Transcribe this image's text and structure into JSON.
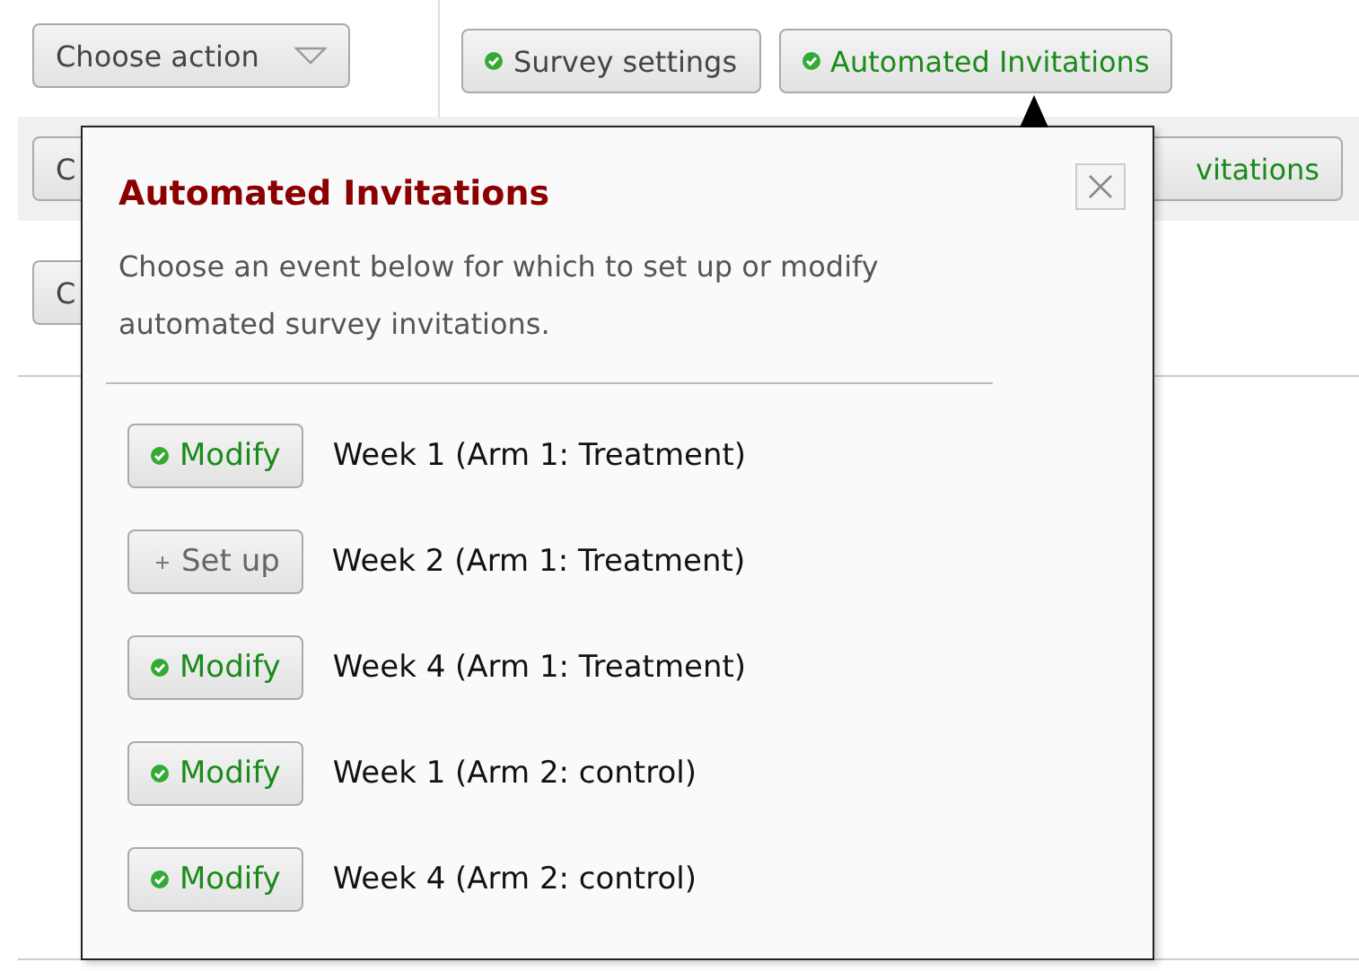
{
  "toolbar": {
    "action_menu": {
      "label": "Choose action"
    },
    "buttons": [
      {
        "label": "Survey settings",
        "highlighted": false
      },
      {
        "label": "Automated Invitations",
        "highlighted": true
      }
    ]
  },
  "rows_behind": [
    {
      "left_button": "C",
      "right_button": "vitations"
    },
    {
      "left_button": "C"
    }
  ],
  "popover": {
    "title": "Automated Invitations",
    "description": "Choose an event below for which to set up or modify automated survey invitations.",
    "events": [
      {
        "action": {
          "label": "Modify",
          "kind": "modify"
        },
        "name": "Week 1 (Arm 1: Treatment)"
      },
      {
        "action": {
          "label": "Set up",
          "kind": "setup"
        },
        "name": "Week 2 (Arm 1: Treatment)"
      },
      {
        "action": {
          "label": "Modify",
          "kind": "modify"
        },
        "name": "Week 4 (Arm 1: Treatment)"
      },
      {
        "action": {
          "label": "Modify",
          "kind": "modify"
        },
        "name": "Week 1 (Arm 2: control)"
      },
      {
        "action": {
          "label": "Modify",
          "kind": "modify"
        },
        "name": "Week 4 (Arm 2: control)"
      }
    ]
  }
}
